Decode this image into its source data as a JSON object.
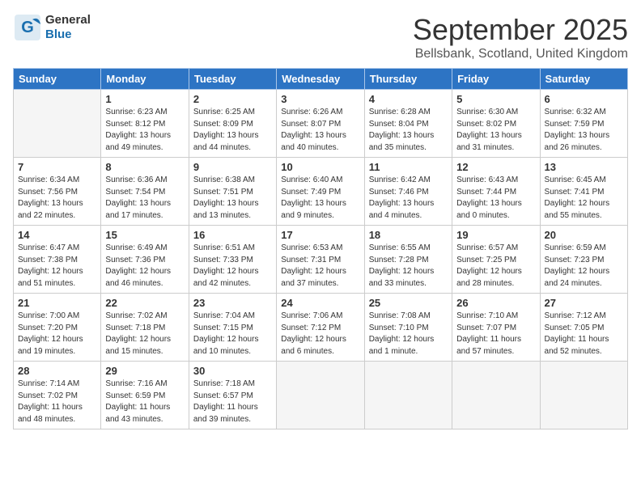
{
  "logo": {
    "general": "General",
    "blue": "Blue"
  },
  "header": {
    "month": "September 2025",
    "location": "Bellsbank, Scotland, United Kingdom"
  },
  "weekdays": [
    "Sunday",
    "Monday",
    "Tuesday",
    "Wednesday",
    "Thursday",
    "Friday",
    "Saturday"
  ],
  "weeks": [
    [
      {
        "day": "",
        "info": ""
      },
      {
        "day": "1",
        "info": "Sunrise: 6:23 AM\nSunset: 8:12 PM\nDaylight: 13 hours\nand 49 minutes."
      },
      {
        "day": "2",
        "info": "Sunrise: 6:25 AM\nSunset: 8:09 PM\nDaylight: 13 hours\nand 44 minutes."
      },
      {
        "day": "3",
        "info": "Sunrise: 6:26 AM\nSunset: 8:07 PM\nDaylight: 13 hours\nand 40 minutes."
      },
      {
        "day": "4",
        "info": "Sunrise: 6:28 AM\nSunset: 8:04 PM\nDaylight: 13 hours\nand 35 minutes."
      },
      {
        "day": "5",
        "info": "Sunrise: 6:30 AM\nSunset: 8:02 PM\nDaylight: 13 hours\nand 31 minutes."
      },
      {
        "day": "6",
        "info": "Sunrise: 6:32 AM\nSunset: 7:59 PM\nDaylight: 13 hours\nand 26 minutes."
      }
    ],
    [
      {
        "day": "7",
        "info": "Sunrise: 6:34 AM\nSunset: 7:56 PM\nDaylight: 13 hours\nand 22 minutes."
      },
      {
        "day": "8",
        "info": "Sunrise: 6:36 AM\nSunset: 7:54 PM\nDaylight: 13 hours\nand 17 minutes."
      },
      {
        "day": "9",
        "info": "Sunrise: 6:38 AM\nSunset: 7:51 PM\nDaylight: 13 hours\nand 13 minutes."
      },
      {
        "day": "10",
        "info": "Sunrise: 6:40 AM\nSunset: 7:49 PM\nDaylight: 13 hours\nand 9 minutes."
      },
      {
        "day": "11",
        "info": "Sunrise: 6:42 AM\nSunset: 7:46 PM\nDaylight: 13 hours\nand 4 minutes."
      },
      {
        "day": "12",
        "info": "Sunrise: 6:43 AM\nSunset: 7:44 PM\nDaylight: 13 hours\nand 0 minutes."
      },
      {
        "day": "13",
        "info": "Sunrise: 6:45 AM\nSunset: 7:41 PM\nDaylight: 12 hours\nand 55 minutes."
      }
    ],
    [
      {
        "day": "14",
        "info": "Sunrise: 6:47 AM\nSunset: 7:38 PM\nDaylight: 12 hours\nand 51 minutes."
      },
      {
        "day": "15",
        "info": "Sunrise: 6:49 AM\nSunset: 7:36 PM\nDaylight: 12 hours\nand 46 minutes."
      },
      {
        "day": "16",
        "info": "Sunrise: 6:51 AM\nSunset: 7:33 PM\nDaylight: 12 hours\nand 42 minutes."
      },
      {
        "day": "17",
        "info": "Sunrise: 6:53 AM\nSunset: 7:31 PM\nDaylight: 12 hours\nand 37 minutes."
      },
      {
        "day": "18",
        "info": "Sunrise: 6:55 AM\nSunset: 7:28 PM\nDaylight: 12 hours\nand 33 minutes."
      },
      {
        "day": "19",
        "info": "Sunrise: 6:57 AM\nSunset: 7:25 PM\nDaylight: 12 hours\nand 28 minutes."
      },
      {
        "day": "20",
        "info": "Sunrise: 6:59 AM\nSunset: 7:23 PM\nDaylight: 12 hours\nand 24 minutes."
      }
    ],
    [
      {
        "day": "21",
        "info": "Sunrise: 7:00 AM\nSunset: 7:20 PM\nDaylight: 12 hours\nand 19 minutes."
      },
      {
        "day": "22",
        "info": "Sunrise: 7:02 AM\nSunset: 7:18 PM\nDaylight: 12 hours\nand 15 minutes."
      },
      {
        "day": "23",
        "info": "Sunrise: 7:04 AM\nSunset: 7:15 PM\nDaylight: 12 hours\nand 10 minutes."
      },
      {
        "day": "24",
        "info": "Sunrise: 7:06 AM\nSunset: 7:12 PM\nDaylight: 12 hours\nand 6 minutes."
      },
      {
        "day": "25",
        "info": "Sunrise: 7:08 AM\nSunset: 7:10 PM\nDaylight: 12 hours\nand 1 minute."
      },
      {
        "day": "26",
        "info": "Sunrise: 7:10 AM\nSunset: 7:07 PM\nDaylight: 11 hours\nand 57 minutes."
      },
      {
        "day": "27",
        "info": "Sunrise: 7:12 AM\nSunset: 7:05 PM\nDaylight: 11 hours\nand 52 minutes."
      }
    ],
    [
      {
        "day": "28",
        "info": "Sunrise: 7:14 AM\nSunset: 7:02 PM\nDaylight: 11 hours\nand 48 minutes."
      },
      {
        "day": "29",
        "info": "Sunrise: 7:16 AM\nSunset: 6:59 PM\nDaylight: 11 hours\nand 43 minutes."
      },
      {
        "day": "30",
        "info": "Sunrise: 7:18 AM\nSunset: 6:57 PM\nDaylight: 11 hours\nand 39 minutes."
      },
      {
        "day": "",
        "info": ""
      },
      {
        "day": "",
        "info": ""
      },
      {
        "day": "",
        "info": ""
      },
      {
        "day": "",
        "info": ""
      }
    ]
  ]
}
